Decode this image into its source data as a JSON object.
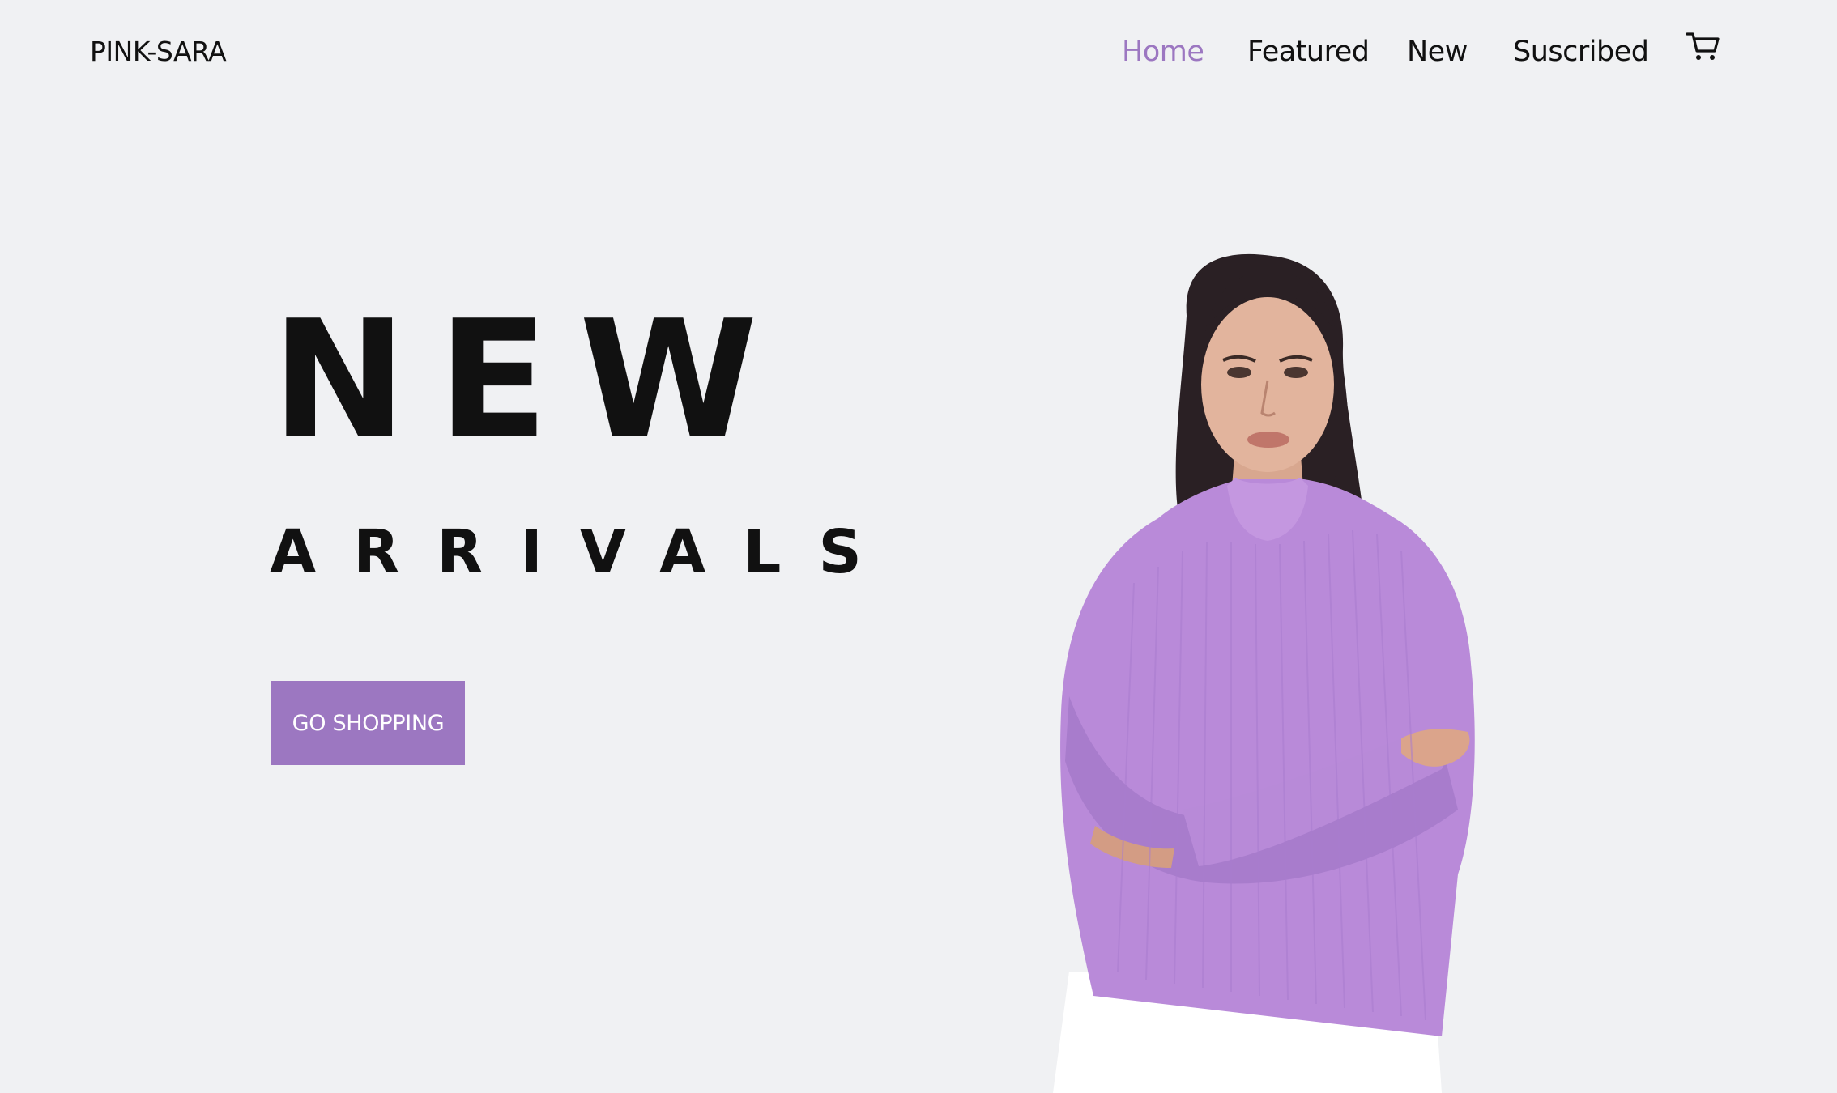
{
  "brand": {
    "name": "PINK-SARA"
  },
  "nav": {
    "items": [
      {
        "label": "Home",
        "active": true
      },
      {
        "label": "Featured",
        "active": false
      },
      {
        "label": "New",
        "active": false
      },
      {
        "label": "Suscribed",
        "active": false
      }
    ],
    "cart_icon": "shopping-cart-icon"
  },
  "hero": {
    "title": "NEW",
    "subtitle": "ARRIVALS",
    "cta_label": "GO SHOPPING",
    "image": "model-in-lilac-sweater"
  },
  "colors": {
    "background": "#f0f1f3",
    "accent": "#9c77c1",
    "text": "#111111"
  }
}
